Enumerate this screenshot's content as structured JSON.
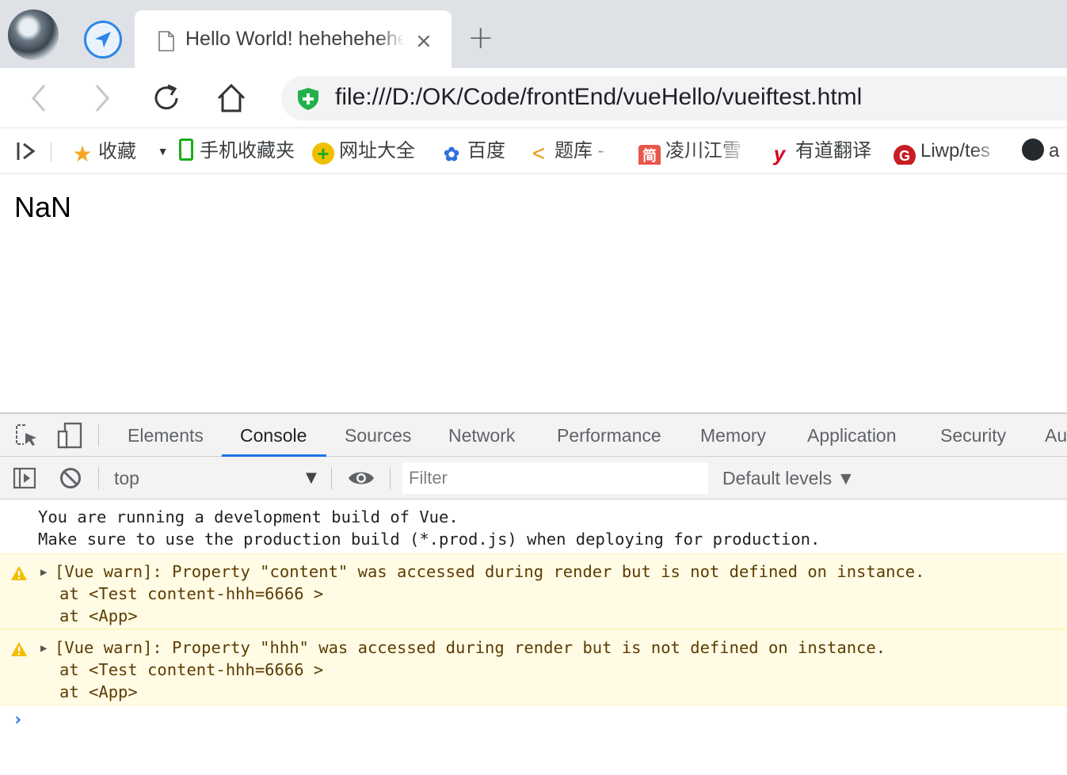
{
  "browser": {
    "tab": {
      "title": "Hello World! hehehehehe",
      "close_glyph": "×"
    },
    "new_tab_glyph": "+",
    "omnibox": {
      "url": "file:///D:/OK/Code/frontEnd/vueHello/vueiftest.html"
    },
    "bookmarks": [
      {
        "label": "收藏",
        "icon": "star-icon",
        "color": "#f5a623"
      },
      {
        "label": "手机收藏夹",
        "icon": "phone-icon",
        "color": "#1aad19"
      },
      {
        "label": "网址大全",
        "icon": "plus-circle-icon",
        "color": "#f0c000"
      },
      {
        "label": "百度",
        "icon": "paw-icon",
        "color": "#2f6fde"
      },
      {
        "label": "题库 -",
        "icon": "bracket-icon",
        "color": "#e8910c"
      },
      {
        "label": "凌川江雪",
        "icon": "jian-icon",
        "color": "#e8564a",
        "icon_text": "简"
      },
      {
        "label": "有道翻译",
        "icon": "youdao-icon",
        "color": "#d8001d",
        "icon_text": "y"
      },
      {
        "label": "Liwp/tes",
        "icon": "gitee-icon",
        "color": "#c71d23",
        "icon_text": "G"
      },
      {
        "label": "a",
        "icon": "github-icon",
        "color": "#24292e"
      }
    ]
  },
  "page": {
    "output": "NaN"
  },
  "devtools": {
    "tabs": [
      "Elements",
      "Console",
      "Sources",
      "Network",
      "Performance",
      "Memory",
      "Application",
      "Security",
      "Au"
    ],
    "active_tab": "Console",
    "console_bar": {
      "context": "top",
      "filter_placeholder": "Filter",
      "levels": "Default levels ▼"
    },
    "messages": {
      "info": [
        "You are running a development build of Vue.",
        "Make sure to use the production build (*.prod.js) when deploying for production."
      ],
      "warnings": [
        {
          "text": "[Vue warn]: Property \"content\" was accessed during render but is not defined on instance.",
          "trace": [
            "at <Test content-hhh=6666 >",
            "at <App>"
          ]
        },
        {
          "text": "[Vue warn]: Property \"hhh\" was accessed during render but is not defined on instance.",
          "trace": [
            "at <Test content-hhh=6666 >",
            "at <App>"
          ]
        }
      ]
    },
    "prompt_glyph": "›"
  }
}
